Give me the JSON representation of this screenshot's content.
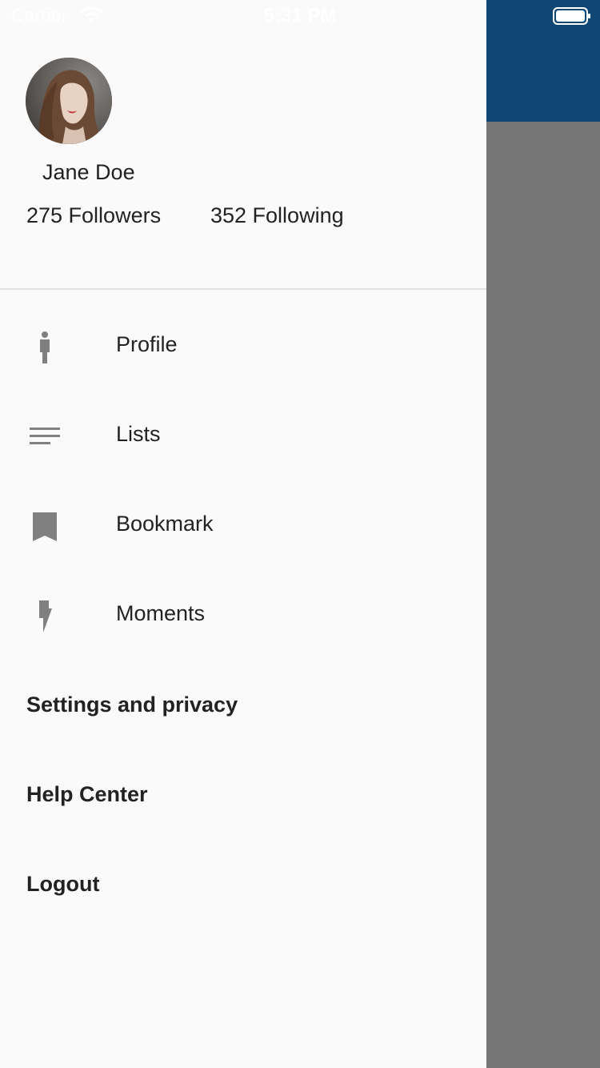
{
  "status_bar": {
    "carrier": "Carrier",
    "time": "5:31 PM"
  },
  "user": {
    "name": "Jane Doe",
    "followers": "275 Followers",
    "following": "352 Following"
  },
  "menu": {
    "items": [
      {
        "label": "Profile",
        "icon": "person-icon"
      },
      {
        "label": "Lists",
        "icon": "list-icon"
      },
      {
        "label": "Bookmark",
        "icon": "bookmark-icon"
      },
      {
        "label": "Moments",
        "icon": "lightning-icon"
      }
    ],
    "links": [
      {
        "label": "Settings and privacy"
      },
      {
        "label": "Help Center"
      },
      {
        "label": "Logout"
      }
    ]
  },
  "colors": {
    "app_bar": "#104674",
    "drawer_bg": "#fafafa",
    "scrim": "#767676",
    "icon": "#808080",
    "text": "#222222"
  }
}
